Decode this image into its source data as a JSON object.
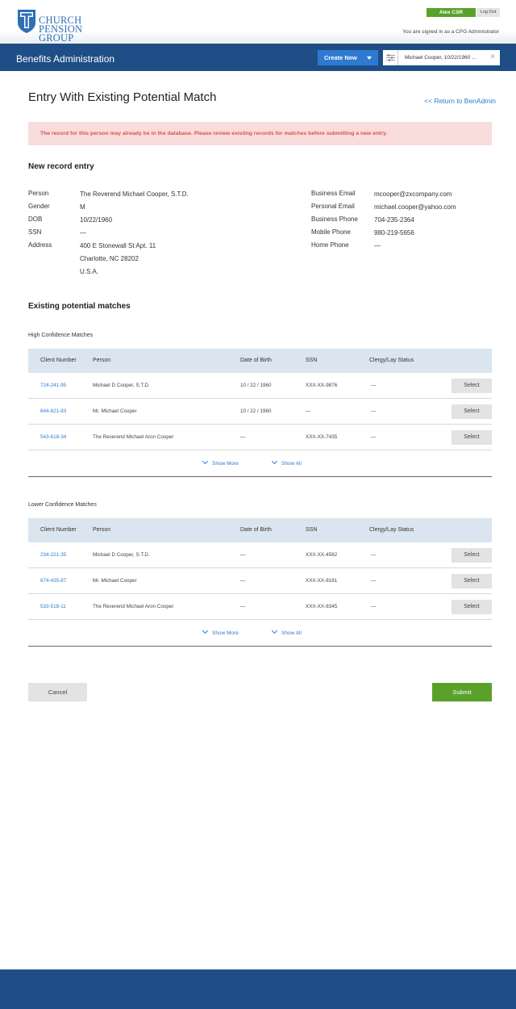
{
  "header": {
    "logo_line1": "CHURCH",
    "logo_line2": "PENSION GROUP",
    "user_name": "Alex CSR",
    "logout_label": "Log Out",
    "signed_in_text": "You are signed in as a CPG Administrator"
  },
  "nav": {
    "title": "Benefits Administration",
    "create_new_label": "Create New",
    "search_value": "Michael Cooper, 10/22/1960 ...",
    "clear_icon": "×"
  },
  "page": {
    "title": "Entry With Existing Potential Match",
    "return_link": "<< Return to BenAdmin",
    "alert": "The record for this person may already be in the database. Please review existing records for matches before submitting a new entry."
  },
  "new_record": {
    "section_title": "New record entry",
    "person_label": "Person",
    "person_value": "The Reverend Michael Cooper, S.T.D.",
    "gender_label": "Gender",
    "gender_value": "M",
    "dob_label": "DOB",
    "dob_value": "10/22/1960",
    "ssn_label": "SSN",
    "ssn_value": "—",
    "address_label": "Address",
    "address_line1": "400 E Stonewall St  Apt. 11",
    "address_line2": "Charlotte, NC 28202",
    "address_line3": "U.S.A.",
    "business_email_label": "Business Email",
    "business_email_value": "mcooper@zxcompany.com",
    "personal_email_label": "Personal Email",
    "personal_email_value": "michael.cooper@yahoo.com",
    "business_phone_label": "Business Phone",
    "business_phone_value": "704-235-2364",
    "mobile_phone_label": "Mobile Phone",
    "mobile_phone_value": "980-219-5656",
    "home_phone_label": "Home Phone",
    "home_phone_value": "—"
  },
  "matches": {
    "section_title": "Existing potential matches",
    "columns": {
      "client_number": "Client Number",
      "person": "Person",
      "dob": "Date of Birth",
      "ssn": "SSN",
      "status": "Clergy/Lay Status"
    },
    "select_label": "Select",
    "show_more_label": "Show More",
    "show_all_label": "Show All",
    "high": {
      "title": "High Confidence Matches",
      "rows": [
        {
          "client": "724-241-95",
          "person": "Michael D Cooper, S.T.D.",
          "dob": "10 / 22 / 1960",
          "ssn": "XXX-XX-9876",
          "status": "—"
        },
        {
          "client": "644-621-83",
          "person": "Mr. Michael Cooper",
          "dob": "10 / 22 / 1960",
          "ssn": "—",
          "status": "—"
        },
        {
          "client": "543-618-34",
          "person": "The Reverend Michael Aron Cooper",
          "dob": "—",
          "ssn": "XXX-XX-7435",
          "status": "—"
        }
      ]
    },
    "lower": {
      "title": "Lower Confidence Matches",
      "rows": [
        {
          "client": "234-221-35",
          "person": "Michael D Cooper, S.T.D.",
          "dob": "—",
          "ssn": "XXX-XX-4562",
          "status": "—"
        },
        {
          "client": "674-435-87",
          "person": "Mr. Michael Cooper",
          "dob": "—",
          "ssn": "XXX-XX-8161",
          "status": "—"
        },
        {
          "client": "533-518-11",
          "person": "The Reverend Michael Aron Cooper",
          "dob": "—",
          "ssn": "XXX-XX-8345",
          "status": "—"
        }
      ]
    }
  },
  "actions": {
    "cancel_label": "Cancel",
    "submit_label": "Submit"
  }
}
